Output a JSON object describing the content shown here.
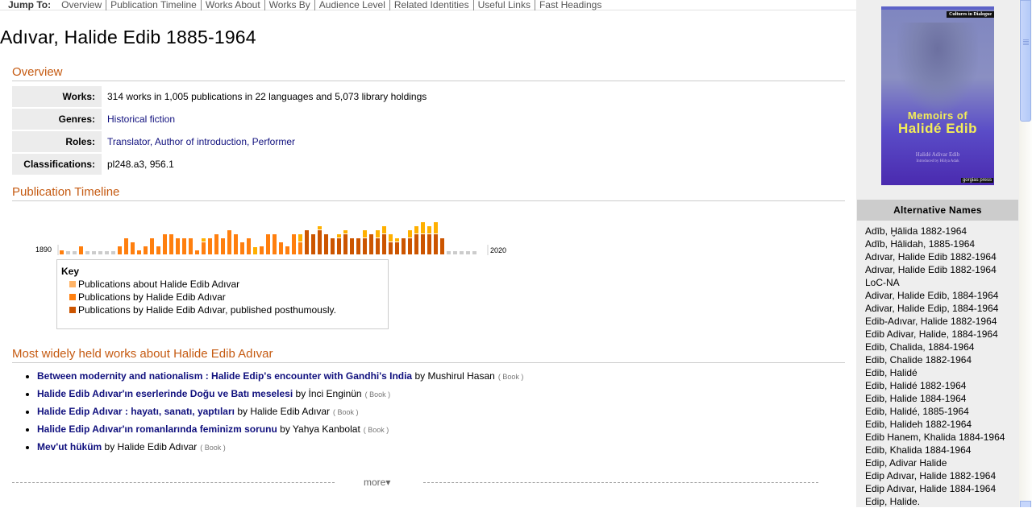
{
  "jump_bar": {
    "label": "Jump To:",
    "links": [
      "Overview",
      "Publication Timeline",
      "Works About",
      "Works By",
      "Audience Level",
      "Related Identities",
      "Useful Links",
      "Fast Headings"
    ]
  },
  "page_title": "Adıvar, Halide Edib 1885-1964",
  "overview": {
    "heading": "Overview",
    "rows": [
      {
        "label": "Works:",
        "value": "314 works in 1,005 publications in 22 languages and 5,073 library holdings",
        "is_link": false
      },
      {
        "label": "Genres:",
        "value": "Historical fiction",
        "is_link": true
      },
      {
        "label": "Roles:",
        "value": "Translator, Author of introduction, Performer",
        "is_link": true
      },
      {
        "label": "Classifications:",
        "value": "pl248.a3, 956.1",
        "is_link": false
      }
    ]
  },
  "timeline": {
    "heading": "Publication Timeline",
    "key_title": "Key",
    "key_items": [
      {
        "label": "Publications about Halide Edib Adıvar",
        "color": "#ffb366"
      },
      {
        "label": "Publications by Halide Edib Adıvar",
        "color": "#ff7f0e"
      },
      {
        "label": "Publications by Halide Edib Adıvar, published posthumously.",
        "color": "#cc5500"
      }
    ]
  },
  "chart_data": {
    "type": "bar",
    "title": "Publication Timeline",
    "x_start_label": "1890",
    "x_end_label": "2020",
    "colors": {
      "none": "#cccccc",
      "by": "#ff7f0e",
      "posthumous": "#cc5500",
      "about": "#ffb000"
    },
    "note": "Relative heights in units (1 unit ≈ one level step); stacked: main + about",
    "bars": [
      {
        "main": 1,
        "kind": "by",
        "about": 0
      },
      {
        "main": 0,
        "kind": "none",
        "about": 0
      },
      {
        "main": 0,
        "kind": "none",
        "about": 0
      },
      {
        "main": 2,
        "kind": "by",
        "about": 0
      },
      {
        "main": 0,
        "kind": "none",
        "about": 0
      },
      {
        "main": 0,
        "kind": "none",
        "about": 0
      },
      {
        "main": 0,
        "kind": "none",
        "about": 0
      },
      {
        "main": 0,
        "kind": "none",
        "about": 0
      },
      {
        "main": 0,
        "kind": "none",
        "about": 0
      },
      {
        "main": 2,
        "kind": "by",
        "about": 0
      },
      {
        "main": 4,
        "kind": "by",
        "about": 0
      },
      {
        "main": 3,
        "kind": "by",
        "about": 0
      },
      {
        "main": 1,
        "kind": "by",
        "about": 0
      },
      {
        "main": 2,
        "kind": "by",
        "about": 0
      },
      {
        "main": 4,
        "kind": "by",
        "about": 0
      },
      {
        "main": 2,
        "kind": "by",
        "about": 0
      },
      {
        "main": 5,
        "kind": "by",
        "about": 0
      },
      {
        "main": 5,
        "kind": "by",
        "about": 0
      },
      {
        "main": 4,
        "kind": "by",
        "about": 0
      },
      {
        "main": 4,
        "kind": "by",
        "about": 0
      },
      {
        "main": 4,
        "kind": "by",
        "about": 0
      },
      {
        "main": 1,
        "kind": "by",
        "about": 0
      },
      {
        "main": 3,
        "kind": "by",
        "about": 1
      },
      {
        "main": 4,
        "kind": "by",
        "about": 0
      },
      {
        "main": 5,
        "kind": "by",
        "about": 0
      },
      {
        "main": 4,
        "kind": "by",
        "about": 0
      },
      {
        "main": 6,
        "kind": "by",
        "about": 0
      },
      {
        "main": 5,
        "kind": "by",
        "about": 0
      },
      {
        "main": 3,
        "kind": "by",
        "about": 0
      },
      {
        "main": 4,
        "kind": "by",
        "about": 0
      },
      {
        "main": 0,
        "kind": "by",
        "about": 2
      },
      {
        "main": 2,
        "kind": "by",
        "about": 0
      },
      {
        "main": 5,
        "kind": "by",
        "about": 0
      },
      {
        "main": 5,
        "kind": "by",
        "about": 0
      },
      {
        "main": 3,
        "kind": "by",
        "about": 0
      },
      {
        "main": 2,
        "kind": "by",
        "about": 0
      },
      {
        "main": 5,
        "kind": "by",
        "about": 0
      },
      {
        "main": 3,
        "kind": "by",
        "about": 2
      },
      {
        "main": 6,
        "kind": "posthumous",
        "about": 0
      },
      {
        "main": 5,
        "kind": "posthumous",
        "about": 0
      },
      {
        "main": 6,
        "kind": "posthumous",
        "about": 1
      },
      {
        "main": 5,
        "kind": "posthumous",
        "about": 0
      },
      {
        "main": 4,
        "kind": "posthumous",
        "about": 0
      },
      {
        "main": 4,
        "kind": "posthumous",
        "about": 1
      },
      {
        "main": 5,
        "kind": "posthumous",
        "about": 1
      },
      {
        "main": 4,
        "kind": "posthumous",
        "about": 0
      },
      {
        "main": 4,
        "kind": "posthumous",
        "about": 0
      },
      {
        "main": 4,
        "kind": "posthumous",
        "about": 2
      },
      {
        "main": 5,
        "kind": "posthumous",
        "about": 0
      },
      {
        "main": 4,
        "kind": "posthumous",
        "about": 2
      },
      {
        "main": 5,
        "kind": "posthumous",
        "about": 2
      },
      {
        "main": 3,
        "kind": "posthumous",
        "about": 2
      },
      {
        "main": 3,
        "kind": "posthumous",
        "about": 1
      },
      {
        "main": 4,
        "kind": "posthumous",
        "about": 0
      },
      {
        "main": 4,
        "kind": "posthumous",
        "about": 2
      },
      {
        "main": 5,
        "kind": "posthumous",
        "about": 2
      },
      {
        "main": 5,
        "kind": "posthumous",
        "about": 3
      },
      {
        "main": 5,
        "kind": "posthumous",
        "about": 2
      },
      {
        "main": 5,
        "kind": "posthumous",
        "about": 3
      },
      {
        "main": 4,
        "kind": "posthumous",
        "about": 0
      },
      {
        "main": 0,
        "kind": "none",
        "about": 0
      },
      {
        "main": 0,
        "kind": "none",
        "about": 0
      },
      {
        "main": 0,
        "kind": "none",
        "about": 0
      },
      {
        "main": 0,
        "kind": "none",
        "about": 0
      },
      {
        "main": 0,
        "kind": "none",
        "about": 0
      }
    ]
  },
  "works_about": {
    "heading": "Most widely held works about Halide Edib Adıvar",
    "items": [
      {
        "title": "Between modernity and nationalism : Halide Edip's encounter with Gandhi's India",
        "by": "by Mushirul Hasan",
        "format": "( Book )"
      },
      {
        "title": "Halide Edib Adıvar'ın eserlerinde Doğu ve Batı meselesi",
        "by": "by İnci Enginün",
        "format": "( Book )"
      },
      {
        "title": "Halide Edip Adıvar : hayatı, sanatı, yaptıları",
        "by": "by Halide Edib Adıvar",
        "format": "( Book )"
      },
      {
        "title": "Halide Edip Adıvar'ın romanlarında feminizm sorunu",
        "by": "by Yahya Kanbolat",
        "format": "( Book )"
      },
      {
        "title": "Mev'ut hüküm",
        "by": "by Halide Edib Adıvar",
        "format": "( Book )"
      }
    ],
    "more_label": "more▾"
  },
  "sidebar": {
    "cover": {
      "series": "Cultures in Dialogue",
      "title_line1": "Memoirs of",
      "title_line2": "Halidé Edib",
      "author": "Halidé Adivar Edib",
      "intro": "Introduced by Hülya Adak",
      "publisher": "gorgias press"
    },
    "alt_names_heading": "Alternative Names",
    "alt_names": [
      "Adīb, Ḫālida 1882-1964",
      "Adīb, Hālidah, 1885-1964",
      "Adıvar, Halide Edib 1882-1964",
      "Adıvar, Halide Edib 1882-1964",
      "LoC-NA",
      "Adivar, Halide Edib, 1884-1964",
      "Adivar, Halide Edip, 1884-1964",
      "Edib-Adıvar, Halide 1882-1964",
      "Edib Adivar, Halide, 1884-1964",
      "Edib, Chalida, 1884-1964",
      "Edib, Chalide 1882-1964",
      "Edib, Halidé",
      "Edib, Halidé 1882-1964",
      "Edib, Halide 1884-1964",
      "Edib, Halidé, 1885-1964",
      "Edib, Halideh 1882-1964",
      "Edib Hanem, Khalida 1884-1964",
      "Edib, Khalida 1884-1964",
      "Edip, Adivar Halide",
      "Edip Adıvar, Halide 1882-1964",
      "Edip Adıvar, Halide 1884-1964",
      "Edip, Halide."
    ]
  }
}
